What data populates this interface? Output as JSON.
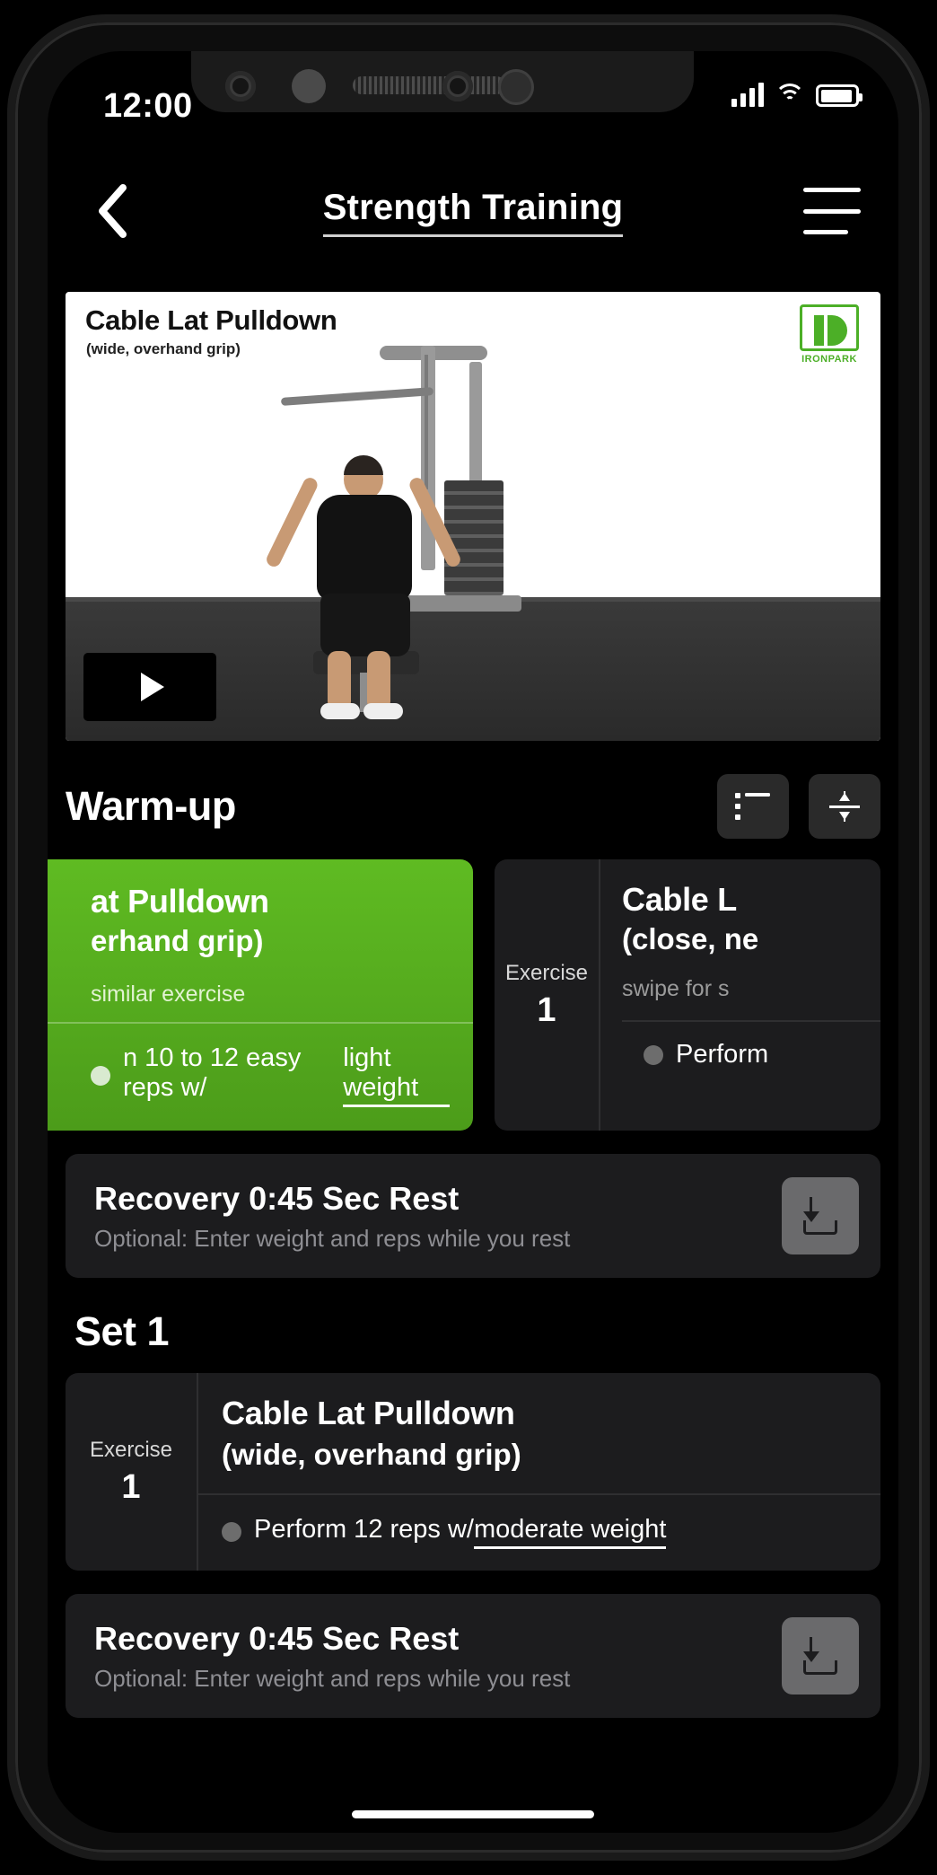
{
  "status_bar": {
    "time": "12:00",
    "cellular_icon": "signal-bars-icon",
    "wifi_icon": "wifi-icon",
    "battery_icon": "battery-icon"
  },
  "header": {
    "back_icon": "chevron-left-icon",
    "title": "Strength Training",
    "menu_icon": "hamburger-menu-icon"
  },
  "video": {
    "title": "Cable Lat Pulldown",
    "subtitle": "(wide, overhand grip)",
    "brand_name": "IRONPARK",
    "brand_accent": "#4caf27",
    "play_icon": "play-icon"
  },
  "warmup_section": {
    "title": "Warm-up",
    "list_view_icon": "list-view-icon",
    "collapse_icon": "collapse-vertical-icon",
    "cards": [
      {
        "variant": "green",
        "exercise_name": "at Pulldown",
        "grip": "erhand grip)",
        "swipe_hint": "similar exercise",
        "instruction_prefix": "n 10 to 12 easy reps w/ ",
        "instruction_emphasis": "light weight",
        "bullet_icon": "bullet-dot-icon"
      },
      {
        "variant": "dark",
        "exercise_label": "Exercise",
        "exercise_number": "1",
        "exercise_name": "Cable L",
        "grip": "(close, ne",
        "swipe_hint": "swipe for s",
        "instruction_prefix": "Perform",
        "bullet_icon": "bullet-dot-icon"
      }
    ]
  },
  "recovery_1": {
    "title": "Recovery 0:45 Sec Rest",
    "subtitle": "Optional: Enter weight and reps while you rest",
    "download_icon": "download-icon"
  },
  "set_1": {
    "title": "Set 1",
    "exercise_label": "Exercise",
    "exercise_number": "1",
    "exercise_name": "Cable Lat Pulldown",
    "grip": "(wide, overhand grip)",
    "instruction_prefix": "Perform 12 reps w/ ",
    "instruction_emphasis": "moderate weight",
    "bullet_icon": "bullet-dot-icon"
  },
  "recovery_2": {
    "title": "Recovery 0:45 Sec Rest",
    "subtitle": "Optional: Enter weight and reps while you rest",
    "download_icon": "download-icon"
  }
}
